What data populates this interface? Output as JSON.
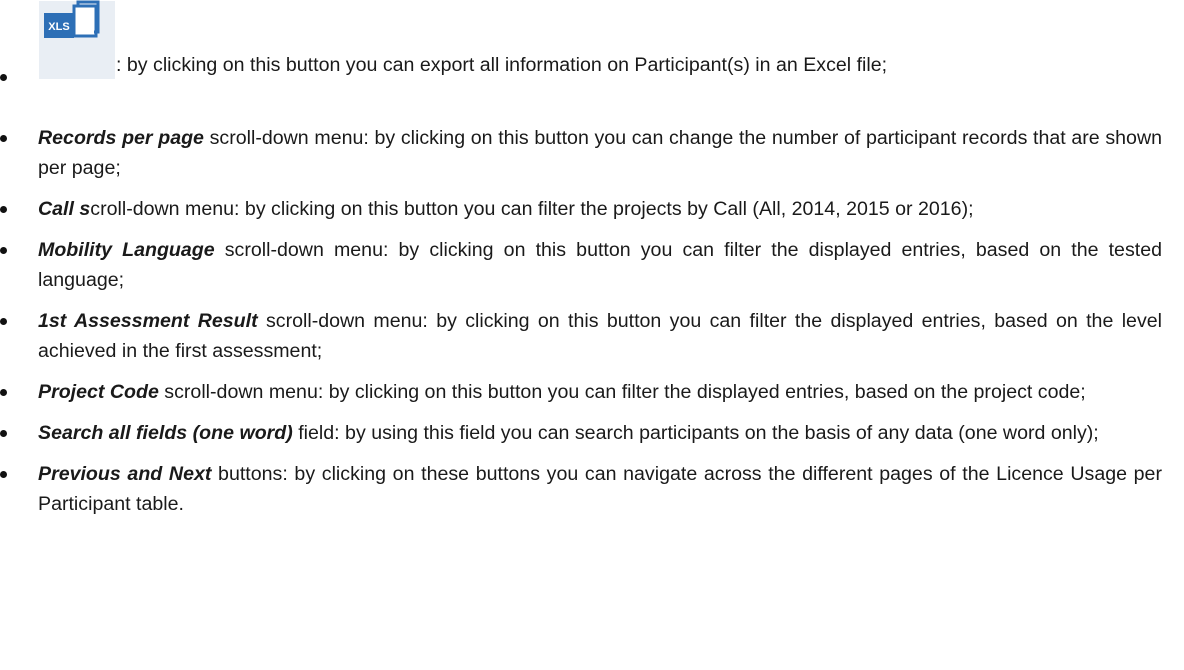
{
  "items": [
    {
      "icon": "excel-export-icon",
      "icon_label": "XLS",
      "description": ": by clicking on this button you can export all information on Participant(s) in an Excel file;"
    },
    {
      "term": "Records per page",
      "description": " scroll-down menu: by clicking on this button you can change the number of participant records that are shown per page;"
    },
    {
      "term": "Call s",
      "description": "croll-down menu: by clicking on this button you can filter the projects by Call (All, 2014, 2015 or 2016);"
    },
    {
      "term": "Mobility Language",
      "description": " scroll-down menu: by clicking on this button you can filter the displayed entries, based on the tested language;"
    },
    {
      "term": "1st Assessment Result",
      "description": " scroll-down menu: by clicking on this button you can filter the displayed entries, based on the level achieved in the first assessment;"
    },
    {
      "term": "Project Code",
      "description": " scroll-down menu: by clicking on this button you can filter the displayed entries, based on the project code;"
    },
    {
      "term": "Search all fields (one word)",
      "description": " field: by using this field you can search participants on the basis of any data (one word only);"
    },
    {
      "term": "Previous and Next",
      "description": " buttons: by clicking on these buttons you can navigate across the different pages of the Licence Usage per Participant table."
    }
  ],
  "colors": {
    "text": "#1a1a1a",
    "icon_blue": "#2d6fb6",
    "icon_background": "#e9eef4"
  }
}
